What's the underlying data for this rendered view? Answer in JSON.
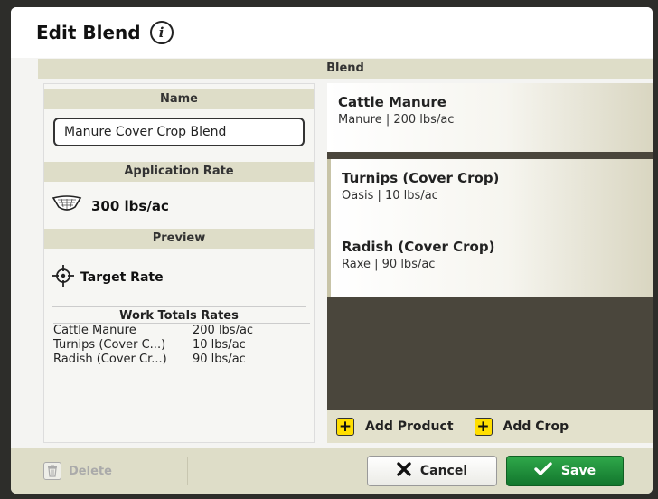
{
  "window": {
    "title": "Edit Blend",
    "info_icon": "info-icon"
  },
  "blend": {
    "header": "Blend"
  },
  "name_section": {
    "header": "Name",
    "value": "Manure Cover Crop Blend"
  },
  "application_rate": {
    "header": "Application Rate",
    "icon": "hopper-icon",
    "value": "300 lbs/ac"
  },
  "preview": {
    "header": "Preview",
    "icon": "crosshair-icon",
    "target_label": "Target Rate",
    "totals_header": "Work Totals Rates",
    "rows": [
      {
        "name": "Cattle Manure",
        "rate": "200 lbs/ac"
      },
      {
        "name": "Turnips (Cover C...)",
        "rate": "10 lbs/ac"
      },
      {
        "name": "Radish (Cover Cr...)",
        "rate": "90 lbs/ac"
      }
    ]
  },
  "products": [
    {
      "name": "Cattle Manure",
      "desc": "Manure | 200 lbs/ac"
    },
    {
      "name": "Turnips (Cover Crop)",
      "desc": "Oasis | 10 lbs/ac"
    },
    {
      "name": "Radish (Cover Crop)",
      "desc": "Raxe | 90 lbs/ac"
    }
  ],
  "actions": {
    "add_product": "Add Product",
    "add_crop": "Add Crop",
    "delete": "Delete",
    "cancel": "Cancel",
    "save": "Save"
  },
  "colors": {
    "accent_green": "#1f8f3a",
    "add_yellow": "#ffde00",
    "header_beige": "#deddc8",
    "empty_area": "#4a463c"
  }
}
